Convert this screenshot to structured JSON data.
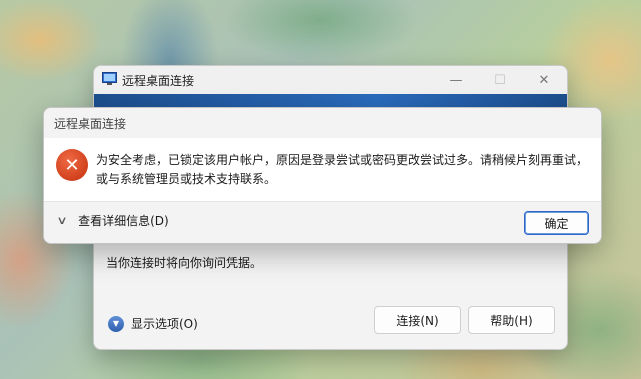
{
  "background_window": {
    "title": "远程桌面连接",
    "controls": {
      "minimize": "—",
      "maximize": "☐",
      "close": "✕"
    },
    "prompt": "当你连接时将向你询问凭据。",
    "show_options_label": "显示选项(O)",
    "connect_label": "连接(N)",
    "help_label": "帮助(H)"
  },
  "dialog": {
    "title": "远程桌面连接",
    "icon": "error-icon",
    "icon_glyph": "✕",
    "message_line1": "为安全考虑，已锁定该用户帐户，原因是登录尝试或密码更改尝试过多。请稍候片刻再重试，",
    "message_line2": "或与系统管理员或技术支持联系。",
    "details_label": "查看详细信息(D)",
    "ok_label": "确定"
  },
  "colors": {
    "error_red": "#d1411d",
    "accent_blue": "#2a67c7"
  }
}
